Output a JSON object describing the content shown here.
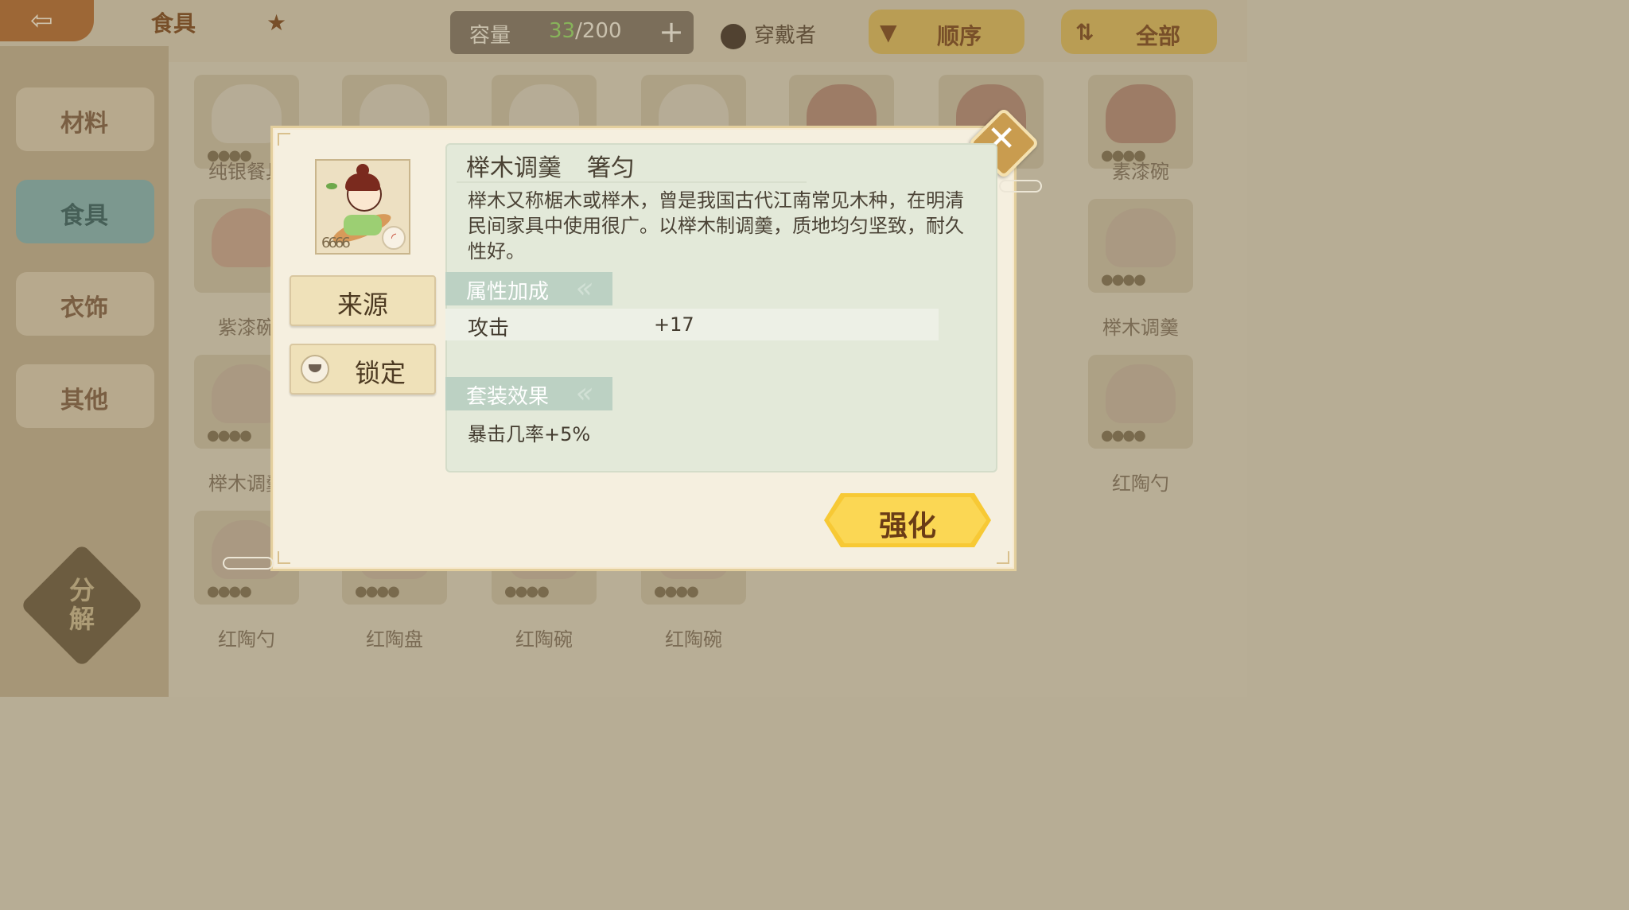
{
  "header": {
    "back_icon": "back-arrow-icon",
    "title": "食具",
    "star_icon": "star-icon",
    "capacity_label": "容量",
    "capacity_used": "33",
    "capacity_total": "/200",
    "wearer_label": "穿戴者",
    "sort_label": "顺序",
    "filter_label": "全部"
  },
  "sidebar": {
    "items": [
      {
        "label": "材料"
      },
      {
        "label": "食具"
      },
      {
        "label": "衣饰"
      },
      {
        "label": "其他"
      }
    ],
    "decompose_label": "分解"
  },
  "grid_labels": [
    "纯银餐具",
    "素漆碗",
    "榉木调羹",
    "紫漆碗",
    "榉木调羹",
    "红陶勺",
    "红陶勺",
    "红陶盘",
    "红陶碗",
    "红陶碗"
  ],
  "modal": {
    "item_name": "榉木调羹",
    "item_type": "箸匀",
    "description": "榉木又称椐木或榉木，曾是我国古代江南常见木种，在明清民间家具中使用很广。以榉木制调羹，质地均匀坚致，耐久性好。",
    "source_button": "来源",
    "lock_button": "锁定",
    "attributes_title": "属性加成",
    "attribute_name": "攻击",
    "attribute_value": "+17",
    "set_title": "套装效果",
    "set_effect": "暴击几率+5%",
    "enhance_button": "强化",
    "item_icon": "chef-spoon-character-icon",
    "item_stars": "6666"
  },
  "colors": {
    "enhance_yellow": "#f7c935",
    "section_green": "#bcd1c3",
    "close_gold": "#c99c4f"
  }
}
